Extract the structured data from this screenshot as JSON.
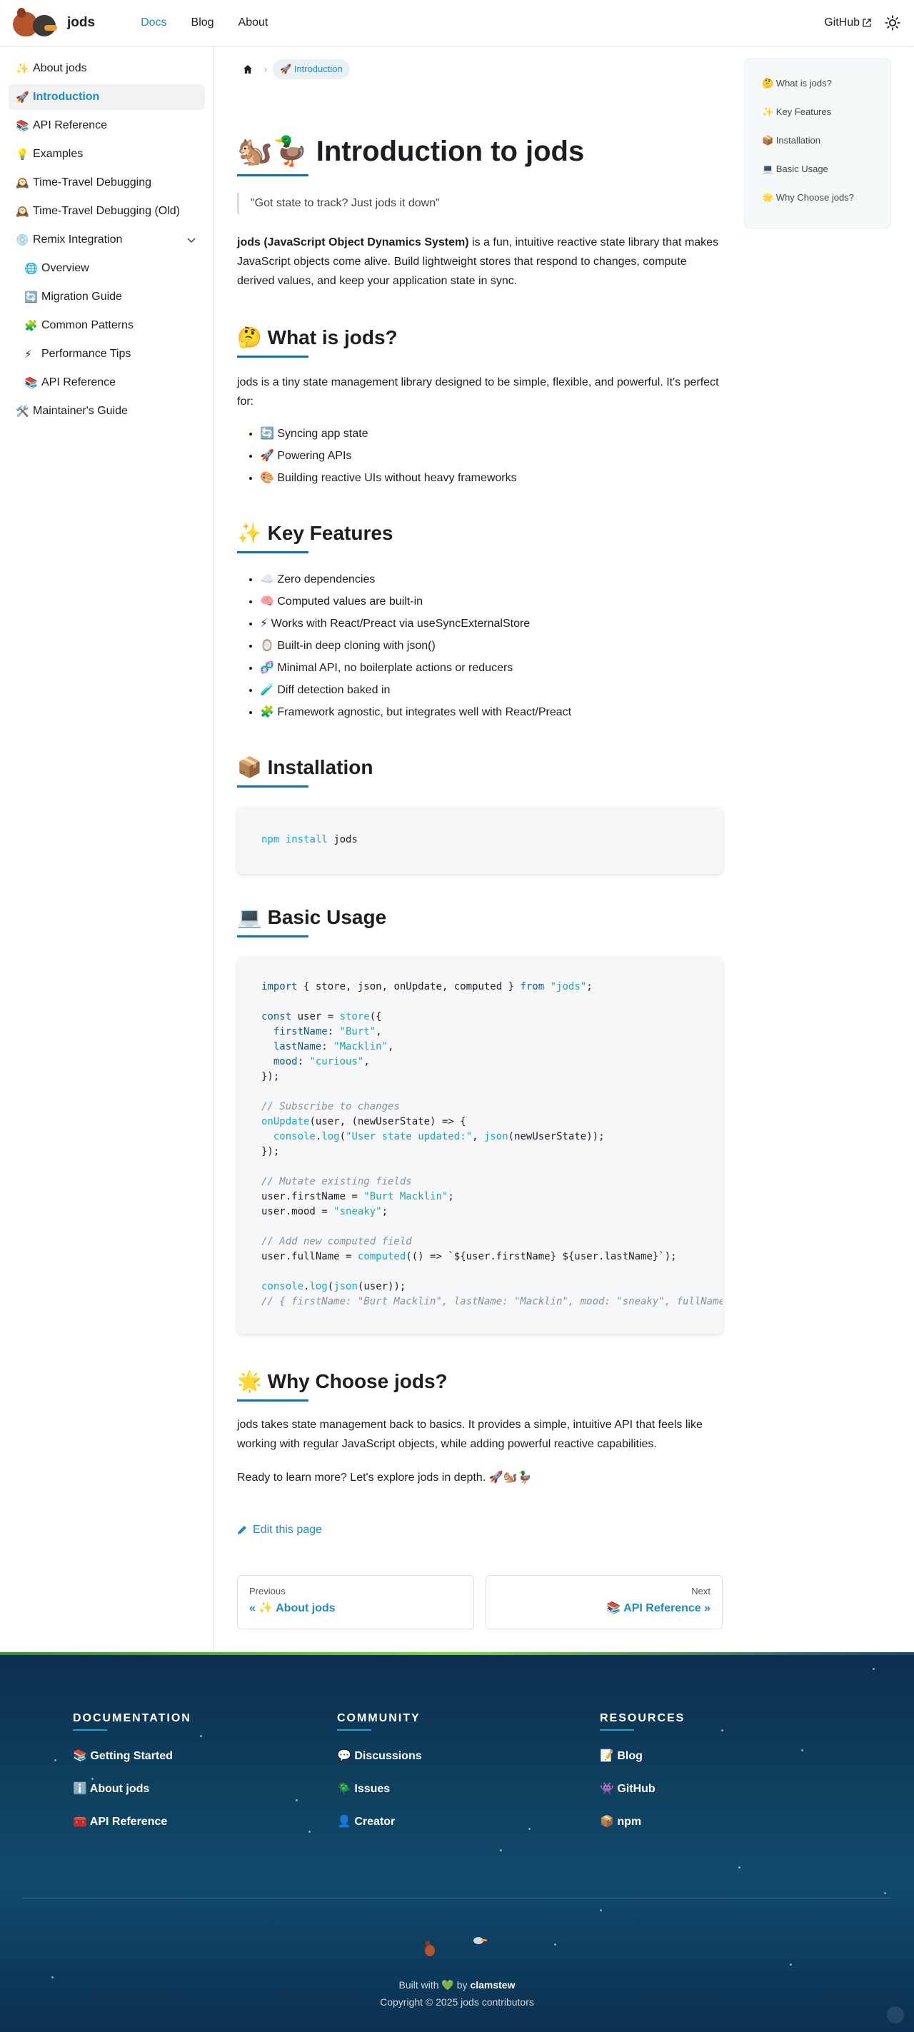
{
  "navbar": {
    "title": "jods",
    "links": [
      "Docs",
      "Blog",
      "About"
    ],
    "github": "GitHub"
  },
  "sidebar": {
    "items": [
      {
        "emoji": "✨",
        "label": "About jods"
      },
      {
        "emoji": "🚀",
        "label": "Introduction"
      },
      {
        "emoji": "📚",
        "label": "API Reference"
      },
      {
        "emoji": "💡",
        "label": "Examples"
      },
      {
        "emoji": "🕰️",
        "label": "Time-Travel Debugging"
      },
      {
        "emoji": "🕰️",
        "label": "Time-Travel Debugging (Old)"
      },
      {
        "emoji": "💿",
        "label": "Remix Integration"
      },
      {
        "emoji": "🌐",
        "label": "Overview"
      },
      {
        "emoji": "🔄",
        "label": "Migration Guide"
      },
      {
        "emoji": "🧩",
        "label": "Common Patterns"
      },
      {
        "emoji": "⚡",
        "label": "Performance Tips"
      },
      {
        "emoji": "📚",
        "label": "API Reference"
      },
      {
        "emoji": "🛠️",
        "label": "Maintainer's Guide"
      }
    ]
  },
  "breadcrumb": {
    "current": "🚀 Introduction"
  },
  "toc": {
    "items": [
      "🤔 What is jods?",
      "✨ Key Features",
      "📦 Installation",
      "💻 Basic Usage",
      "🌟 Why Choose jods?"
    ]
  },
  "content": {
    "title": "🐿️🦆 Introduction to jods",
    "quote": "\"Got state to track? Just jods it down\"",
    "intro_bold": "jods (JavaScript Object Dynamics System)",
    "intro_rest": " is a fun, intuitive reactive state library that makes JavaScript objects come alive. Build lightweight stores that respond to changes, compute derived values, and keep your application state in sync.",
    "what_title": "🤔 What is jods?",
    "what_text": "jods is a tiny state management library designed to be simple, flexible, and powerful. It's perfect for:",
    "what_list": [
      "🔄 Syncing app state",
      "🚀 Powering APIs",
      "🎨 Building reactive UIs without heavy frameworks"
    ],
    "features_title": "✨ Key Features",
    "features_list": [
      "☁️ Zero dependencies",
      "🧠 Computed values are built-in",
      "⚡ Works with React/Preact via useSyncExternalStore",
      "🪞 Built-in deep cloning with json()",
      "🧬 Minimal API, no boilerplate actions or reducers",
      "🧪 Diff detection baked in",
      "🧩 Framework agnostic, but integrates well with React/Preact"
    ],
    "install_title": "📦 Installation",
    "install_cmd1": "npm",
    "install_cmd2": "install",
    "install_cmd3": "jods",
    "usage_title": "💻 Basic Usage",
    "why_title": "🌟 Why Choose jods?",
    "why_text": "jods takes state management back to basics. It provides a simple, intuitive API that feels like working with regular JavaScript objects, while adding powerful reactive capabilities.",
    "why_text2": "Ready to learn more? Let's explore jods in depth. 🚀🐿️🦆",
    "edit": "Edit this page",
    "prev_sub": "Previous",
    "prev_label": "« ✨ About jods",
    "next_sub": "Next",
    "next_label": "📚 API Reference »"
  },
  "footer": {
    "documentation": {
      "head": "DOCUMENTATION",
      "links": [
        "📚 Getting Started",
        "ℹ️ About jods",
        "🧰 API Reference"
      ]
    },
    "community": {
      "head": "COMMUNITY",
      "links": [
        "💬 Discussions",
        "🪲 Issues",
        "👤 Creator"
      ]
    },
    "resources": {
      "head": "RESOURCES",
      "links": [
        "📝 Blog",
        "👾 GitHub",
        "📦 npm"
      ]
    },
    "built_pre": "Built with",
    "built_heart": "💚",
    "built_by": "by",
    "built_author": "clamstew",
    "copyright": "Copyright © 2025 jods contributors"
  },
  "colors": {
    "accent": "#1f8bc0",
    "footer_bg": "#0f4260"
  }
}
